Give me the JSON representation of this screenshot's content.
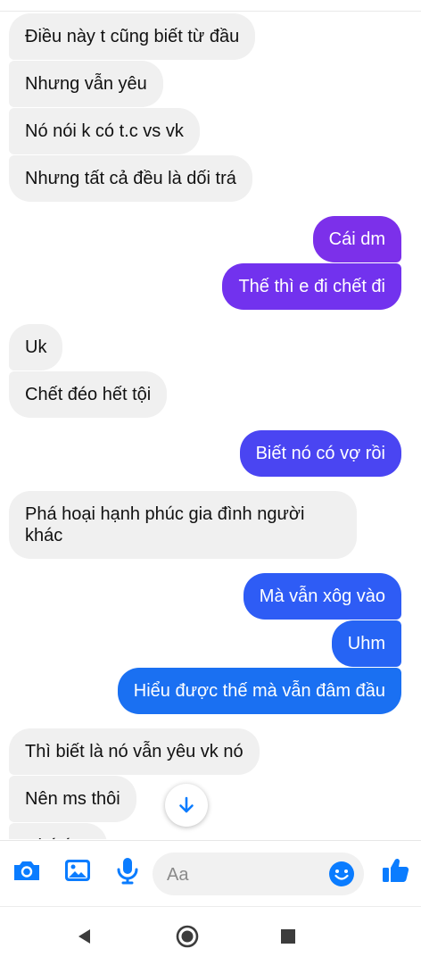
{
  "colors": {
    "incoming_bg": "#f0f0f0",
    "outgoing_gradient": [
      "#8a2be6",
      "#5b3df5",
      "#2f5ff7",
      "#1877f2"
    ],
    "accent": "#0a7cff"
  },
  "messages": [
    {
      "dir": "in",
      "text": "Điều này t cũng biết từ đầu"
    },
    {
      "dir": "in",
      "text": "Nhưng vẫn yêu"
    },
    {
      "dir": "in",
      "text": "Nó nói k có t.c vs vk"
    },
    {
      "dir": "in",
      "text": "Nhưng tất cả đều là dối trá"
    },
    {
      "dir": "out",
      "text": "Cái dm"
    },
    {
      "dir": "out",
      "text": "Thế thì e đi chết đi"
    },
    {
      "dir": "in",
      "text": "Uk"
    },
    {
      "dir": "in",
      "text": "Chết đéo hết tội"
    },
    {
      "dir": "out",
      "text": "Biết nó có vợ rồi"
    },
    {
      "dir": "in",
      "text": "Phá hoại hạnh phúc gia đình người khác"
    },
    {
      "dir": "out",
      "text": "Mà vẫn xôg vào"
    },
    {
      "dir": "out",
      "text": "Uhm"
    },
    {
      "dir": "out",
      "text": "Hiểu được thế mà vẫn đâm đầu"
    },
    {
      "dir": "in",
      "text": "Thì biết là nó vẫn yêu vk nó"
    },
    {
      "dir": "in",
      "text": "Nên ms thôi"
    },
    {
      "dir": "in",
      "text": "Chú ý ..."
    }
  ],
  "composer": {
    "placeholder": "Aa",
    "icons": [
      "camera-icon",
      "image-icon",
      "microphone-icon",
      "emoji-icon",
      "thumbs-up-icon"
    ]
  },
  "navigation": {
    "icons": [
      "back-icon",
      "home-icon",
      "recents-icon"
    ]
  },
  "scroll_button": {
    "icon": "arrow-down-icon"
  }
}
